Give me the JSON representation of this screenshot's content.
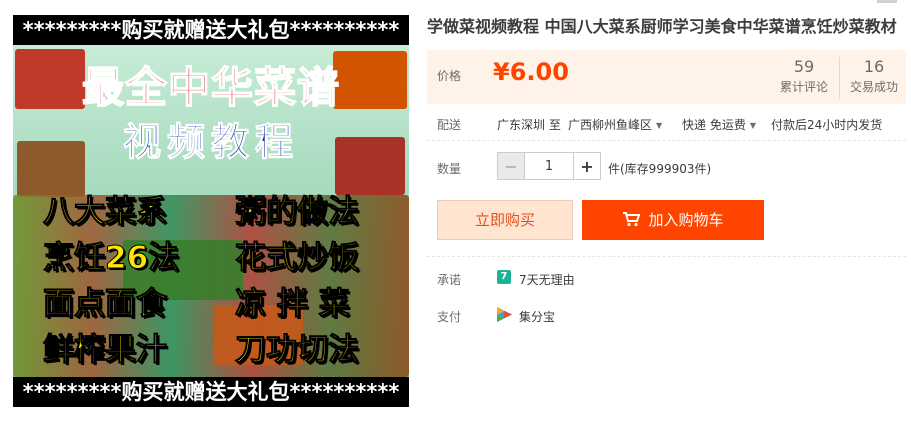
{
  "product_image": {
    "banner_top": "*********购买就赠送大礼包**********",
    "banner_bottom": "*********购买就赠送大礼包**********",
    "headline": "最全中华菜谱",
    "subhead": "视频教程",
    "features": [
      "八大菜系",
      "粥的做法",
      "烹饪26法",
      "花式炒饭",
      "面点面食",
      "凉 拌 菜",
      "鲜榨果汁",
      "刀功切法"
    ]
  },
  "product": {
    "title": "学做菜视频教程 中国八大菜系厨师学习美食中华菜谱烹饪炒菜教材"
  },
  "price": {
    "label": "价格",
    "value": "¥6.00",
    "reviews_count": "59",
    "reviews_label": "累计评论",
    "deals_count": "16",
    "deals_label": "交易成功"
  },
  "delivery": {
    "label": "配送",
    "from": "广东深圳 至",
    "to": "广西柳州鱼峰区",
    "shipping": "快递 免运费",
    "dispatch": "付款后24小时内发货"
  },
  "quantity": {
    "label": "数量",
    "minus": "−",
    "value": "1",
    "plus": "+",
    "stock": "件(库存999903件)"
  },
  "actions": {
    "buy_now": "立即购买",
    "add_to_cart": "加入购物车"
  },
  "promise": {
    "label": "承诺",
    "badge": "7",
    "text": "7天无理由"
  },
  "payment": {
    "label": "支付",
    "text": "集分宝"
  },
  "colors": {
    "accent": "#ff4400",
    "price_bg": "#fff2e8",
    "buy_bg": "#ffe4d0",
    "promise_green": "#1ab394"
  }
}
